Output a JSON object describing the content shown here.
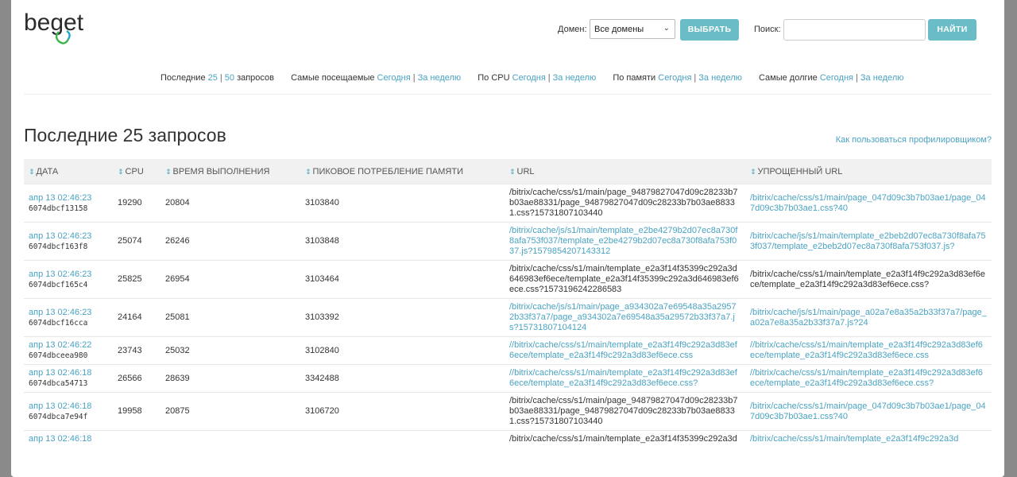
{
  "logo": {
    "text": "beget"
  },
  "controls": {
    "domain_label": "Домен:",
    "domain_selected": "Все домены",
    "select_button": "ВЫБРАТЬ",
    "search_label": "Поиск:",
    "search_value": "",
    "find_button": "НАЙТИ"
  },
  "filters": {
    "last_label": "Последние",
    "last_25": "25",
    "last_50": "50",
    "last_suffix": "запросов",
    "visited_label": "Самые посещаемые",
    "cpu_label": "По CPU",
    "memory_label": "По памяти",
    "long_label": "Самые долгие",
    "today": "Сегодня",
    "week": "За неделю",
    "separator": "|"
  },
  "main": {
    "title": "Последние 25 запросов",
    "help_link": "Как пользоваться профилировщиком?"
  },
  "table": {
    "headers": {
      "date": "ДАТА",
      "cpu": "CPU",
      "time": "ВРЕМЯ ВЫПОЛНЕНИЯ",
      "memory": "ПИКОВОЕ ПОТРЕБЛЕНИЕ ПАМЯТИ",
      "url": "URL",
      "simple_url": "УПРОЩЕННЫЙ URL"
    },
    "rows": [
      {
        "date": "апр 13 02:46:23",
        "id": "6074dbcf13158",
        "cpu": "19290",
        "time": "20804",
        "memory": "3103840",
        "url": "/bitrix/cache/css/s1/main/page_94879827047d09c28233b7b03ae88331/page_94879827047d09c28233b7b03ae88331.css?15731807103440",
        "url_link": false,
        "simple_url": "/bitrix/cache/css/s1/main/page_047d09c3b7b03ae1/page_047d09c3b7b03ae1.css?40",
        "simple_link": true
      },
      {
        "date": "апр 13 02:46:23",
        "id": "6074dbcf163f8",
        "cpu": "25074",
        "time": "26246",
        "memory": "3103848",
        "url": "/bitrix/cache/js/s1/main/template_e2be4279b2d07ec8a730f8afa753f037/template_e2be4279b2d07ec8a730f8afa753f037.js?1579854207143312",
        "url_link": true,
        "simple_url": "/bitrix/cache/js/s1/main/template_e2beb2d07ec8a730f8afa753f037/template_e2beb2d07ec8a730f8afa753f037.js?",
        "simple_link": true
      },
      {
        "date": "апр 13 02:46:23",
        "id": "6074dbcf165c4",
        "cpu": "25825",
        "time": "26954",
        "memory": "3103464",
        "url": "/bitrix/cache/css/s1/main/template_e2a3f14f35399c292a3d646983ef6ece/template_e2a3f14f35399c292a3d646983ef6ece.css?1573196242286583",
        "url_link": false,
        "simple_url": "/bitrix/cache/css/s1/main/template_e2a3f14f9c292a3d83ef6ece/template_e2a3f14f9c292a3d83ef6ece.css?",
        "simple_link": false
      },
      {
        "date": "апр 13 02:46:23",
        "id": "6074dbcf16cca",
        "cpu": "24164",
        "time": "25081",
        "memory": "3103392",
        "url": "/bitrix/cache/js/s1/main/page_a934302a7e69548a35a29572b33f37a7/page_a934302a7e69548a35a29572b33f37a7.js?15731807104124",
        "url_link": true,
        "simple_url": "/bitrix/cache/js/s1/main/page_a02a7e8a35a2b33f37a7/page_a02a7e8a35a2b33f37a7.js?24",
        "simple_link": true
      },
      {
        "date": "апр 13 02:46:22",
        "id": "6074dbceea980",
        "cpu": "23743",
        "time": "25032",
        "memory": "3102840",
        "url": "//bitrix/cache/css/s1/main/template_e2a3f14f9c292a3d83ef6ece/template_e2a3f14f9c292a3d83ef6ece.css",
        "url_link": true,
        "simple_url": "//bitrix/cache/css/s1/main/template_e2a3f14f9c292a3d83ef6ece/template_e2a3f14f9c292a3d83ef6ece.css",
        "simple_link": true
      },
      {
        "date": "апр 13 02:46:18",
        "id": "6074dbca54713",
        "cpu": "26566",
        "time": "28639",
        "memory": "3342488",
        "url": "//bitrix/cache/css/s1/main/template_e2a3f14f9c292a3d83ef6ece/template_e2a3f14f9c292a3d83ef6ece.css?",
        "url_link": true,
        "simple_url": "//bitrix/cache/css/s1/main/template_e2a3f14f9c292a3d83ef6ece/template_e2a3f14f9c292a3d83ef6ece.css?",
        "simple_link": true
      },
      {
        "date": "апр 13 02:46:18",
        "id": "6074dbca7e94f",
        "cpu": "19958",
        "time": "20875",
        "memory": "3106720",
        "url": "/bitrix/cache/css/s1/main/page_94879827047d09c28233b7b03ae88331/page_94879827047d09c28233b7b03ae88331.css?15731807103440",
        "url_link": false,
        "simple_url": "/bitrix/cache/css/s1/main/page_047d09c3b7b03ae1/page_047d09c3b7b03ae1.css?40",
        "simple_link": true
      },
      {
        "date": "апр 13 02:46:18",
        "id": "",
        "cpu": "",
        "time": "",
        "memory": "",
        "url": "/bitrix/cache/css/s1/main/template_e2a3f14f35399c292a3d",
        "url_link": false,
        "simple_url": "/bitrix/cache/css/s1/main/template_e2a3f14f9c292a3d",
        "simple_link": true
      }
    ]
  },
  "colors": {
    "accent": "#4aa3c2",
    "button": "#6abdc6",
    "header_bg": "#f1f1f1"
  }
}
